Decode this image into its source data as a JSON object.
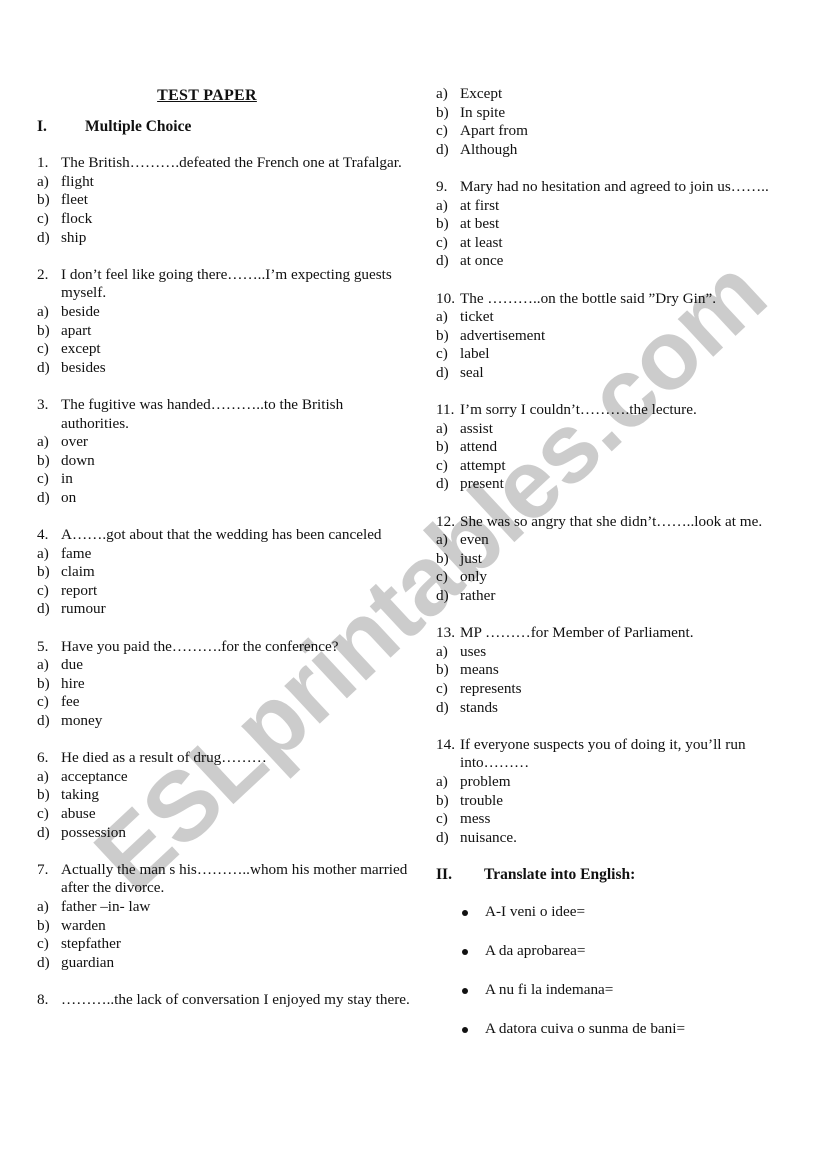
{
  "watermark": "ESLprintables.com",
  "title": "TEST PAPER",
  "section1": {
    "number": "I.",
    "heading": "Multiple Choice"
  },
  "questions": [
    {
      "number": "1.",
      "text": "The British……….defeated the French one at Trafalgar.",
      "options": [
        {
          "letter": "a)",
          "text": "flight"
        },
        {
          "letter": "b)",
          "text": "fleet"
        },
        {
          "letter": "c)",
          "text": "flock"
        },
        {
          "letter": "d)",
          "text": "ship"
        }
      ]
    },
    {
      "number": "2.",
      "text": "I don’t feel like going there……..I’m expecting guests myself.",
      "options": [
        {
          "letter": "a)",
          "text": "beside"
        },
        {
          "letter": "b)",
          "text": "apart"
        },
        {
          "letter": "c)",
          "text": "except"
        },
        {
          "letter": "d)",
          "text": "besides"
        }
      ]
    },
    {
      "number": "3.",
      "text": "The fugitive was handed………..to the British authorities.",
      "options": [
        {
          "letter": "a)",
          "text": "over"
        },
        {
          "letter": "b)",
          "text": "down"
        },
        {
          "letter": "c)",
          "text": "in"
        },
        {
          "letter": "d)",
          "text": "on"
        }
      ]
    },
    {
      "number": "4.",
      "text": "A…….got about that the wedding has been canceled",
      "options": [
        {
          "letter": "a)",
          "text": "fame"
        },
        {
          "letter": "b)",
          "text": "claim"
        },
        {
          "letter": "c)",
          "text": "report"
        },
        {
          "letter": "d)",
          "text": "rumour"
        }
      ]
    },
    {
      "number": "5.",
      "text": "Have you paid the……….for the conference?",
      "options": [
        {
          "letter": "a)",
          "text": "due"
        },
        {
          "letter": "b)",
          "text": "hire"
        },
        {
          "letter": "c)",
          "text": "fee"
        },
        {
          "letter": "d)",
          "text": "money"
        }
      ]
    },
    {
      "number": "6.",
      "text": "He died as a result of drug………",
      "options": [
        {
          "letter": "a)",
          "text": "acceptance"
        },
        {
          "letter": "b)",
          "text": "taking"
        },
        {
          "letter": "c)",
          "text": "abuse"
        },
        {
          "letter": "d)",
          "text": "possession"
        }
      ]
    },
    {
      "number": "7.",
      "text": "Actually the man s his………..whom his mother married after the divorce.",
      "options": [
        {
          "letter": "a)",
          "text": "father –in- law"
        },
        {
          "letter": "b)",
          "text": "warden"
        },
        {
          "letter": "c)",
          "text": "stepfather"
        },
        {
          "letter": "d)",
          "text": "guardian"
        }
      ]
    },
    {
      "number": "8.",
      "text": "………..the lack of conversation I enjoyed my stay there.",
      "options": [
        {
          "letter": "a)",
          "text": "Except"
        },
        {
          "letter": "b)",
          "text": "In spite"
        },
        {
          "letter": "c)",
          "text": "Apart from"
        },
        {
          "letter": "d)",
          "text": "Although"
        }
      ]
    },
    {
      "number": "9.",
      "text": "Mary had no hesitation and agreed to join us……..",
      "options": [
        {
          "letter": "a)",
          "text": "at first"
        },
        {
          "letter": "b)",
          "text": "at best"
        },
        {
          "letter": "c)",
          "text": "at least"
        },
        {
          "letter": "d)",
          "text": "at once"
        }
      ]
    },
    {
      "number": "10.",
      "text": " The ………..on the bottle said ”Dry Gin”.",
      "options": [
        {
          "letter": "a)",
          "text": "ticket"
        },
        {
          "letter": "b)",
          "text": "advertisement"
        },
        {
          "letter": "c)",
          "text": "label"
        },
        {
          "letter": "d)",
          "text": "seal"
        }
      ]
    },
    {
      "number": "11.",
      "text": "I’m sorry I couldn’t……….the lecture.",
      "options": [
        {
          "letter": "a)",
          "text": "assist"
        },
        {
          "letter": "b)",
          "text": "attend"
        },
        {
          "letter": "c)",
          "text": "attempt"
        },
        {
          "letter": "d)",
          "text": "present"
        }
      ]
    },
    {
      "number": "12.",
      "text": "She was so angry that she didn’t……..look at me.",
      "options": [
        {
          "letter": "a)",
          "text": "even"
        },
        {
          "letter": "b)",
          "text": "just"
        },
        {
          "letter": "c)",
          "text": "only"
        },
        {
          "letter": "d)",
          "text": "rather"
        }
      ]
    },
    {
      "number": "13.",
      "text": "MP ………for Member of Parliament.",
      "options": [
        {
          "letter": "a)",
          "text": "uses"
        },
        {
          "letter": "b)",
          "text": "means"
        },
        {
          "letter": "c)",
          "text": "represents"
        },
        {
          "letter": "d)",
          "text": "stands"
        }
      ]
    },
    {
      "number": "14.",
      "text": "If everyone suspects you of doing it, you’ll run into………",
      "options": [
        {
          "letter": "a)",
          "text": "problem"
        },
        {
          "letter": "b)",
          "text": "trouble"
        },
        {
          "letter": "c)",
          "text": "mess"
        },
        {
          "letter": "d)",
          "text": "nuisance."
        }
      ]
    }
  ],
  "section2": {
    "number": "II.",
    "heading": "Translate into English:",
    "items": [
      "A-I veni o idee=",
      "A da aprobarea=",
      "A nu fi la indemana=",
      "A datora cuiva o sunma de bani="
    ]
  }
}
